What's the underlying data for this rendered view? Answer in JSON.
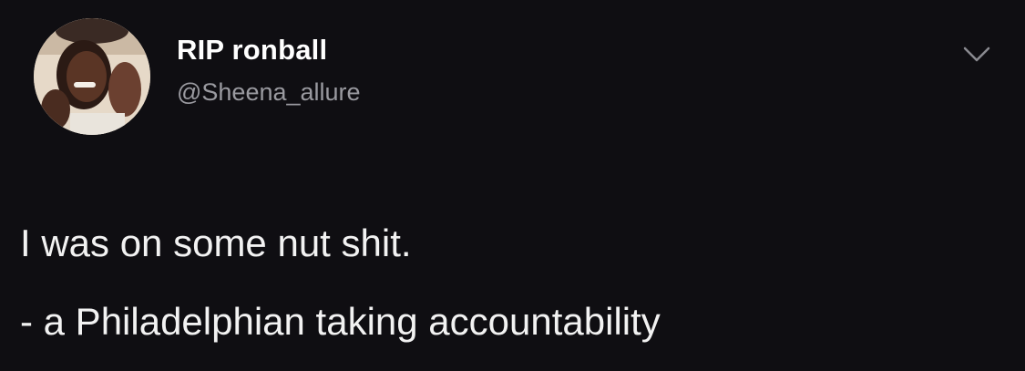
{
  "tweet": {
    "display_name": "RIP ronball",
    "handle": "@Sheena_allure",
    "text_line_1": "I was on some nut shit.",
    "text_line_2": "- a Philadelphian taking accountability"
  },
  "icons": {
    "avatar": "profile-photo",
    "caret": "chevron-down-icon"
  },
  "colors": {
    "background": "#0f0e12",
    "name": "#ffffff",
    "handle": "#9a9aa0",
    "text": "#f2f2f2"
  }
}
